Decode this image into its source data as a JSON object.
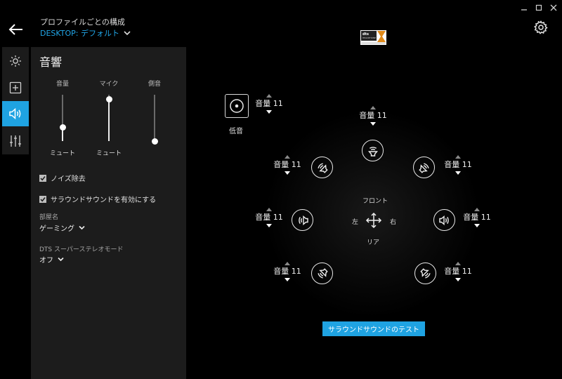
{
  "header": {
    "profile_label": "プロファイルごとの構成",
    "profile_value": "DESKTOP: デフォルト",
    "accent_color": "#1fa3e2"
  },
  "window_controls": [
    "minimize-icon",
    "maximize-icon",
    "close-icon"
  ],
  "rail": {
    "items": [
      {
        "icon": "lighting-icon",
        "active": false
      },
      {
        "icon": "assignments-icon",
        "active": false
      },
      {
        "icon": "audio-icon",
        "active": true
      },
      {
        "icon": "equalizer-icon",
        "active": false
      }
    ]
  },
  "panel": {
    "title": "音響",
    "sliders": [
      {
        "label": "音量",
        "value_text": "ミュート",
        "level": 0.3
      },
      {
        "label": "マイク",
        "value_text": "ミュート",
        "level": 0.9
      },
      {
        "label": "側音",
        "value_text": "",
        "level": 0.0
      }
    ],
    "noise_reduction": {
      "label": "ノイズ除去",
      "checked": true
    },
    "surround": {
      "label": "サラウンドサウンドを有効にする",
      "checked": true
    },
    "room_label": "部屋名",
    "room_value": "ゲーミング",
    "dts_stereo_label": "DTS スーパーステレオモード",
    "dts_stereo_value": "オフ"
  },
  "speakers": {
    "subwoofer": {
      "label": "低音",
      "volume": "音量 11"
    },
    "front_center": {
      "volume": "音量 11"
    },
    "front_left": {
      "volume": "音量 11"
    },
    "front_right": {
      "volume": "音量 11"
    },
    "side_left": {
      "volume": "音量 11"
    },
    "side_right": {
      "volume": "音量 11"
    },
    "rear_left": {
      "volume": "音量 11"
    },
    "rear_right": {
      "volume": "音量 11"
    }
  },
  "directions": {
    "front": "フロント",
    "rear": "リア",
    "left": "左",
    "right": "右"
  },
  "test_button": "サラウンドサウンドのテスト"
}
